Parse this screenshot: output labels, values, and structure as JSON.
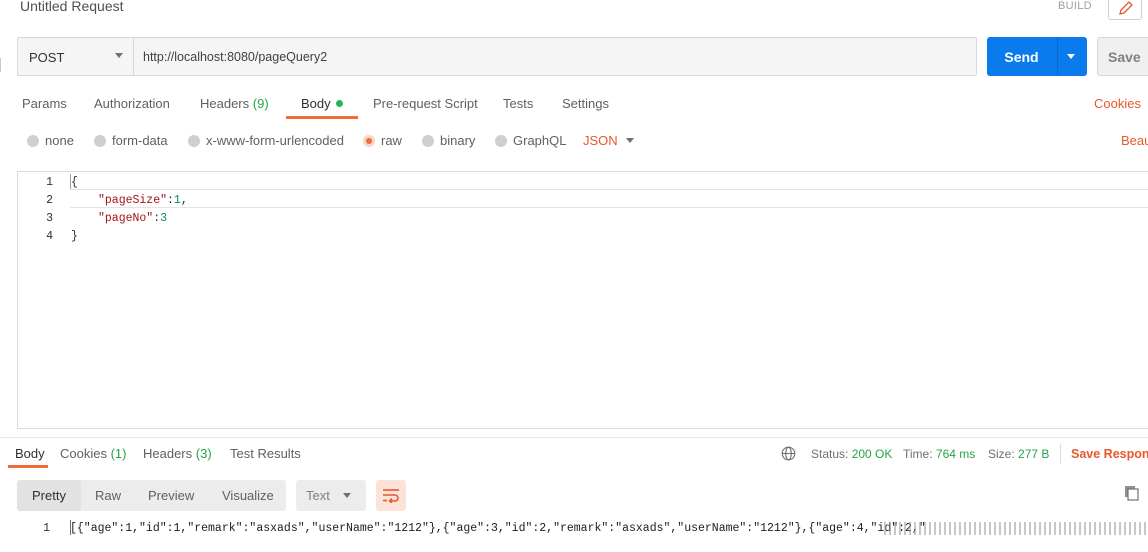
{
  "request": {
    "title": "Untitled Request",
    "build_label": "BUILD",
    "method": "POST",
    "url": "http://localhost:8080/pageQuery2",
    "send_label": "Send",
    "save_label": "Save"
  },
  "request_tabs": [
    {
      "label": "Params"
    },
    {
      "label": "Authorization"
    },
    {
      "label": "Headers",
      "count": "(9)"
    },
    {
      "label": "Body"
    },
    {
      "label": "Pre-request Script"
    },
    {
      "label": "Tests"
    },
    {
      "label": "Settings"
    }
  ],
  "cookies_link": "Cookies",
  "body_types": [
    {
      "label": "none"
    },
    {
      "label": "form-data"
    },
    {
      "label": "x-www-form-urlencoded"
    },
    {
      "label": "raw",
      "selected": true
    },
    {
      "label": "binary"
    },
    {
      "label": "GraphQL"
    }
  ],
  "raw_format": "JSON",
  "beautify_link": "Beau",
  "editor": {
    "lines": [
      {
        "n": "1",
        "text": "{"
      },
      {
        "n": "2",
        "key": "\"pageSize\"",
        "sep": ":",
        "val": "1",
        "tail": ","
      },
      {
        "n": "3",
        "key": "\"pageNo\"",
        "sep": ":",
        "val": "3",
        "tail": ""
      },
      {
        "n": "4",
        "text": "}"
      }
    ]
  },
  "response_tabs": [
    {
      "label": "Body"
    },
    {
      "label": "Cookies",
      "count": "(1)"
    },
    {
      "label": "Headers",
      "count": "(3)"
    },
    {
      "label": "Test Results"
    }
  ],
  "status": {
    "status_label": "Status:",
    "status_value": "200 OK",
    "time_label": "Time:",
    "time_value": "764 ms",
    "size_label": "Size:",
    "size_value": "277 B",
    "save_response": "Save Respons"
  },
  "view_modes": [
    "Pretty",
    "Raw",
    "Preview",
    "Visualize"
  ],
  "response_format": "Text",
  "response": {
    "line_number": "1",
    "text": "[{\"age\":1,\"id\":1,\"remark\":\"asxads\",\"userName\":\"1212\"},{\"age\":3,\"id\":2,\"remark\":\"asxads\",\"userName\":\"1212\"},{\"age\":4,\"id\":2,\""
  },
  "colors": {
    "accent": "#f26b3a",
    "send": "#097bed",
    "success": "#26a24a"
  }
}
